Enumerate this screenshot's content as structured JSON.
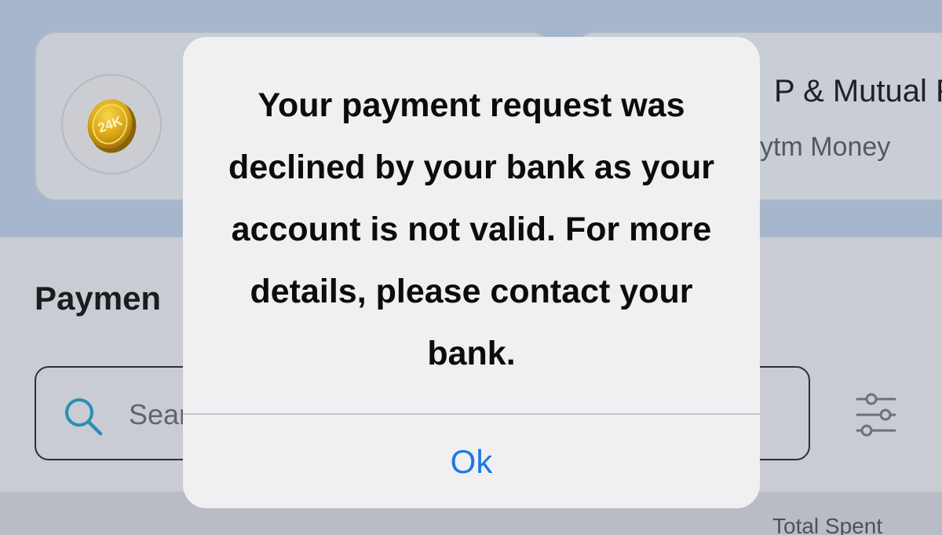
{
  "background": {
    "gold_card": {
      "coin_label": "24K",
      "coin_icon": "gold-coin-icon"
    },
    "sip_card": {
      "title": "P & Mutual F",
      "subtitle": "ytm Money"
    },
    "section_title": "Paymen",
    "search": {
      "placeholder": "Sear",
      "value": ""
    },
    "filter_icon": "sliders-icon",
    "summary_label": "Total Spent"
  },
  "dialog": {
    "message": "Your payment request was declined by your bank as your account is not valid. For more details, please contact your bank.",
    "ok_label": "Ok"
  },
  "colors": {
    "dialog_background": "#f0f0f2",
    "button_blue": "#1a7ae4",
    "search_icon_teal": "#2a8fb5",
    "dim_top_band": "#a6b6cc",
    "dim_body": "#c9ccd2"
  }
}
